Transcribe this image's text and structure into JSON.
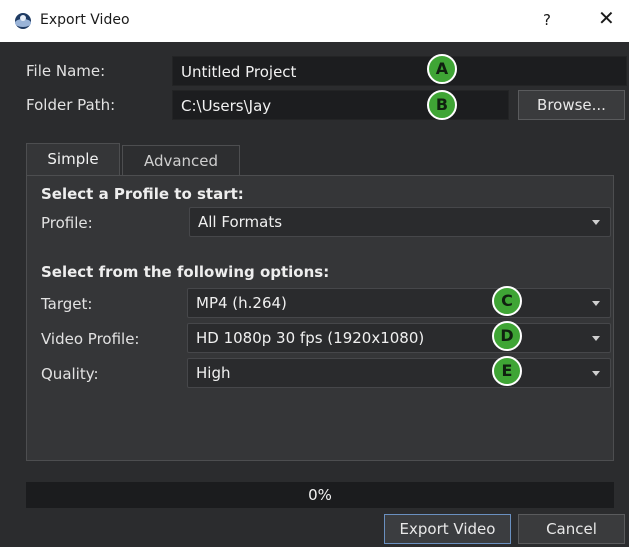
{
  "window": {
    "title": "Export Video",
    "help_label": "?",
    "close_label": "✕"
  },
  "file": {
    "label": "File Name:",
    "value": "Untitled Project"
  },
  "folder": {
    "label": "Folder Path:",
    "value": "C:\\Users\\Jay",
    "browse_label": "Browse..."
  },
  "tabs": [
    {
      "label": "Simple",
      "active": true
    },
    {
      "label": "Advanced",
      "active": false
    }
  ],
  "profile_section": {
    "heading": "Select a Profile to start:",
    "label": "Profile:",
    "value": "All Formats"
  },
  "options_section": {
    "heading": "Select from the following options:",
    "target": {
      "label": "Target:",
      "value": "MP4 (h.264)"
    },
    "video_profile": {
      "label": "Video Profile:",
      "value": "HD 1080p 30 fps (1920x1080)"
    },
    "quality": {
      "label": "Quality:",
      "value": "High"
    }
  },
  "badges": {
    "a": "A",
    "b": "B",
    "c": "C",
    "d": "D",
    "e": "E"
  },
  "progress": {
    "value": 0,
    "label": "0%"
  },
  "buttons": {
    "export": "Export Video",
    "cancel": "Cancel"
  },
  "colors": {
    "badge": "#3fa535",
    "background": "#2b2c2e",
    "field": "#1c1d1f"
  },
  "icons": {
    "app": "openshot-logo-icon",
    "close": "close-icon",
    "dropdown": "chevron-down-icon"
  }
}
